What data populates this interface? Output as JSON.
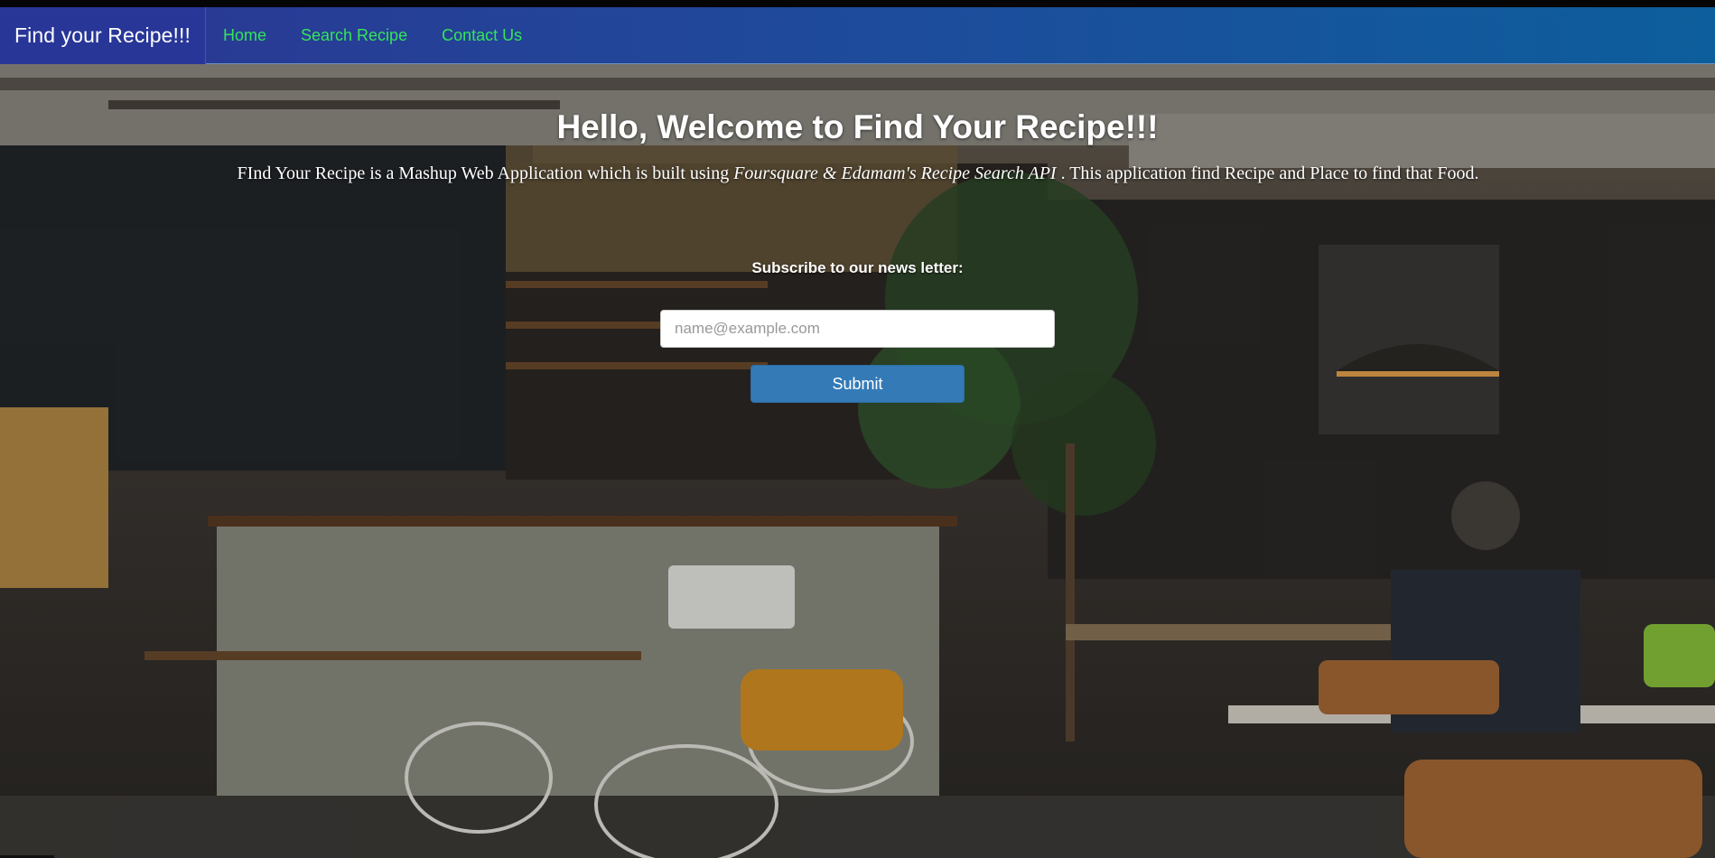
{
  "navbar": {
    "brand": "Find your Recipe!!!",
    "links": [
      {
        "label": "Home"
      },
      {
        "label": "Search Recipe"
      },
      {
        "label": "Contact Us"
      }
    ]
  },
  "hero": {
    "title_prefix": "Hello, Welcome to ",
    "title_strong": "Find Your Recipe!!!",
    "desc_before": "FInd Your Recipe is a Mashup Web Application which is built using ",
    "desc_em": "Foursquare & Edamam's Recipe Search API",
    "desc_after": " . This application find Recipe and Place to find that Food.",
    "subscribe_label": "Subscribe to our news letter:",
    "email_placeholder": "name@example.com",
    "submit_label": "Submit"
  },
  "colors": {
    "nav_link": "#35e45a",
    "brand_bg": "#283698",
    "button_bg": "#337ab7"
  }
}
